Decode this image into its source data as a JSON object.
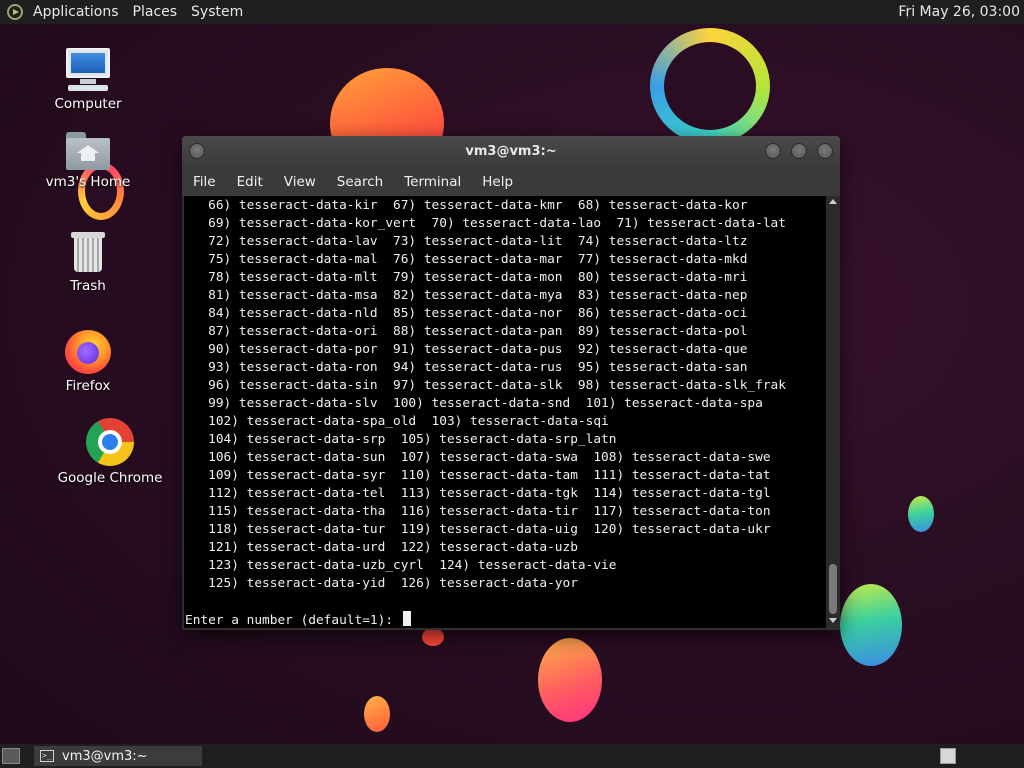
{
  "top_panel": {
    "menus": [
      "Applications",
      "Places",
      "System"
    ],
    "clock": "Fri May 26, 03:00"
  },
  "desktop": {
    "icons": [
      {
        "label": "Computer",
        "icon": "computer-icon"
      },
      {
        "label": "vm3's Home",
        "icon": "home-folder-icon"
      },
      {
        "label": "Trash",
        "icon": "trash-icon"
      },
      {
        "label": "Firefox",
        "icon": "firefox-icon"
      },
      {
        "label": "Google Chrome",
        "icon": "chrome-icon"
      }
    ]
  },
  "window": {
    "title": "vm3@vm3:~",
    "menu": [
      "File",
      "Edit",
      "View",
      "Search",
      "Terminal",
      "Help"
    ],
    "terminal_lines": [
      "   66) tesseract-data-kir  67) tesseract-data-kmr  68) tesseract-data-kor",
      "   69) tesseract-data-kor_vert  70) tesseract-data-lao  71) tesseract-data-lat",
      "   72) tesseract-data-lav  73) tesseract-data-lit  74) tesseract-data-ltz",
      "   75) tesseract-data-mal  76) tesseract-data-mar  77) tesseract-data-mkd",
      "   78) tesseract-data-mlt  79) tesseract-data-mon  80) tesseract-data-mri",
      "   81) tesseract-data-msa  82) tesseract-data-mya  83) tesseract-data-nep",
      "   84) tesseract-data-nld  85) tesseract-data-nor  86) tesseract-data-oci",
      "   87) tesseract-data-ori  88) tesseract-data-pan  89) tesseract-data-pol",
      "   90) tesseract-data-por  91) tesseract-data-pus  92) tesseract-data-que",
      "   93) tesseract-data-ron  94) tesseract-data-rus  95) tesseract-data-san",
      "   96) tesseract-data-sin  97) tesseract-data-slk  98) tesseract-data-slk_frak",
      "   99) tesseract-data-slv  100) tesseract-data-snd  101) tesseract-data-spa",
      "   102) tesseract-data-spa_old  103) tesseract-data-sqi",
      "   104) tesseract-data-srp  105) tesseract-data-srp_latn",
      "   106) tesseract-data-sun  107) tesseract-data-swa  108) tesseract-data-swe",
      "   109) tesseract-data-syr  110) tesseract-data-tam  111) tesseract-data-tat",
      "   112) tesseract-data-tel  113) tesseract-data-tgk  114) tesseract-data-tgl",
      "   115) tesseract-data-tha  116) tesseract-data-tir  117) tesseract-data-ton",
      "   118) tesseract-data-tur  119) tesseract-data-uig  120) tesseract-data-ukr",
      "   121) tesseract-data-urd  122) tesseract-data-uzb",
      "   123) tesseract-data-uzb_cyrl  124) tesseract-data-vie",
      "   125) tesseract-data-yid  126) tesseract-data-yor"
    ],
    "prompt": "Enter a number (default=1): "
  },
  "bottom_panel": {
    "task_label": "vm3@vm3:~"
  }
}
